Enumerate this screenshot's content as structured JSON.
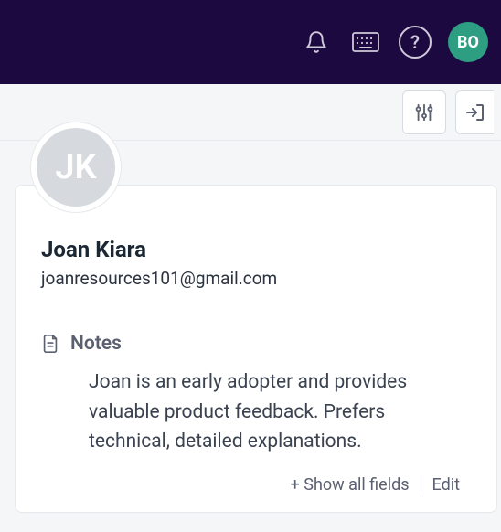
{
  "colors": {
    "topbar_bg": "#1b093f",
    "avatar_bg": "#2e9e83"
  },
  "topbar": {
    "user_initials": "BO"
  },
  "profile": {
    "initials": "JK",
    "name": "Joan Kiara",
    "email": "joanresources101@gmail.com"
  },
  "notes": {
    "label": "Notes",
    "body": "Joan is an early adopter and provides valuable product feedback. Prefers technical, detailed explanations."
  },
  "actions": {
    "show_all": "+ Show all fields",
    "edit": "Edit"
  }
}
